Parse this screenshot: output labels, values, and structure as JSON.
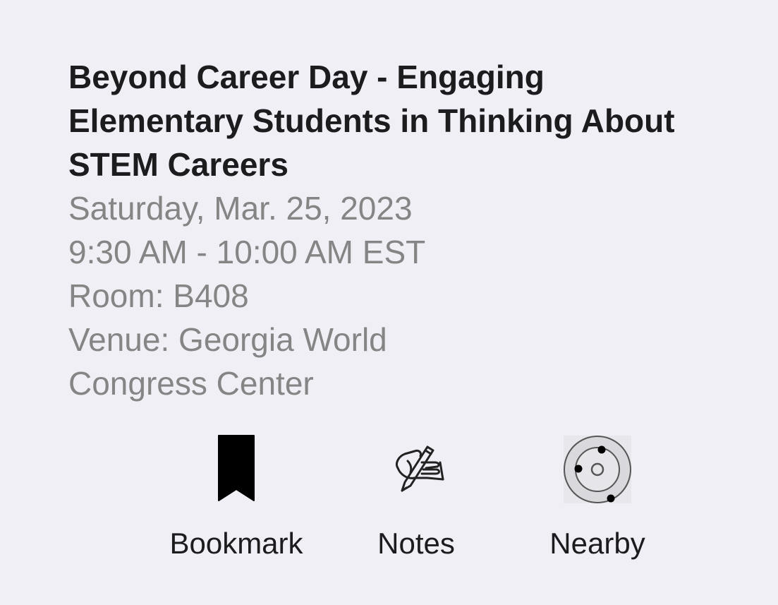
{
  "session": {
    "title": "Beyond Career Day - Engaging Elementary Students in Thinking About STEM Careers",
    "date": "Saturday, Mar. 25, 2023",
    "time": "9:30 AM - 10:00 AM EST",
    "room": "Room: B408",
    "venue_line1": "Venue: Georgia World",
    "venue_line2": "Congress Center"
  },
  "actions": {
    "bookmark": {
      "label": "Bookmark",
      "icon": "bookmark-icon"
    },
    "notes": {
      "label": "Notes",
      "icon": "pen-hand-icon"
    },
    "nearby": {
      "label": "Nearby",
      "icon": "orbit-icon"
    }
  },
  "colors": {
    "background": "#f0eff5",
    "title": "#1c1c1e",
    "meta": "#858585"
  }
}
